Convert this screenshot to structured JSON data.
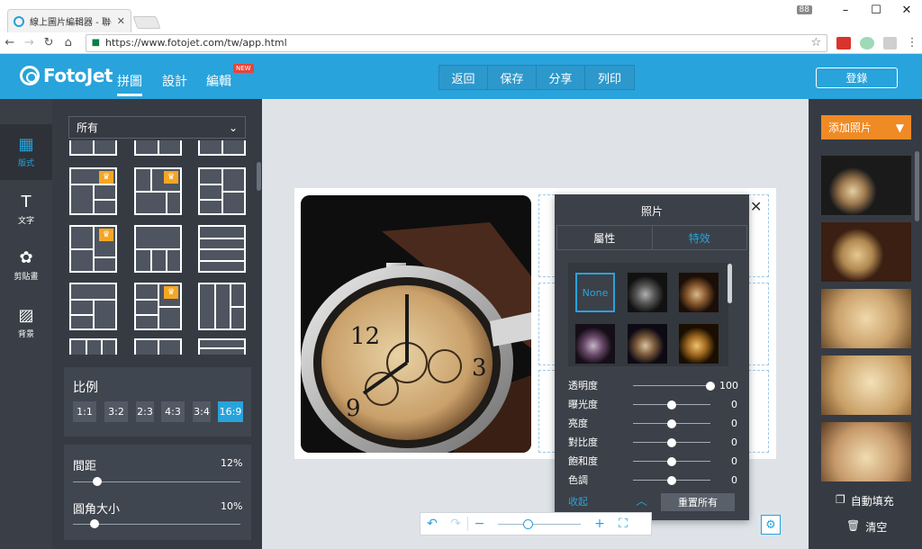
{
  "browser": {
    "tab_title": "線上圖片編輯器 - 聯手相...",
    "window_badge": "88",
    "url": "https://www.fotojet.com/tw/app.html"
  },
  "header": {
    "logo": "FotoJet",
    "nav": [
      "拼圖",
      "設計",
      "編輯"
    ],
    "new_badge": "NEW",
    "actions": [
      "返回",
      "保存",
      "分享",
      "列印"
    ],
    "login": "登錄"
  },
  "sidebar": {
    "items": [
      {
        "label": "版式",
        "icon": "layout-icon"
      },
      {
        "label": "文字",
        "icon": "text-icon"
      },
      {
        "label": "剪貼畫",
        "icon": "clipart-icon"
      },
      {
        "label": "背景",
        "icon": "background-icon"
      }
    ]
  },
  "panel": {
    "filter_selected": "所有",
    "ratio_title": "比例",
    "ratios": [
      "1:1",
      "3:2",
      "2:3",
      "4:3",
      "3:4",
      "16:9"
    ],
    "ratio_active": "16:9",
    "spacing_label": "間距",
    "spacing_value": "12%",
    "spacing_level": 0.12,
    "corner_label": "圓角大小",
    "corner_value": "10%",
    "corner_level": 0.1
  },
  "photo_panel": {
    "title": "照片",
    "tabs": [
      "屬性",
      "特效"
    ],
    "active_tab": "特效",
    "effect_none": "None",
    "adjustments": [
      {
        "label": "透明度",
        "value": "100",
        "level": 1.0
      },
      {
        "label": "曝光度",
        "value": "0",
        "level": 0.5
      },
      {
        "label": "亮度",
        "value": "0",
        "level": 0.5
      },
      {
        "label": "對比度",
        "value": "0",
        "level": 0.5
      },
      {
        "label": "飽和度",
        "value": "0",
        "level": 0.5
      },
      {
        "label": "色調",
        "value": "0",
        "level": 0.5
      }
    ],
    "collapse": "收起",
    "reset": "重置所有"
  },
  "right": {
    "add_photos": "添加照片",
    "auto_fill": "自動填充",
    "clear": "清空"
  },
  "colors": {
    "accent": "#29a3db",
    "orange": "#f08a24",
    "dark_panel": "#363b43"
  }
}
